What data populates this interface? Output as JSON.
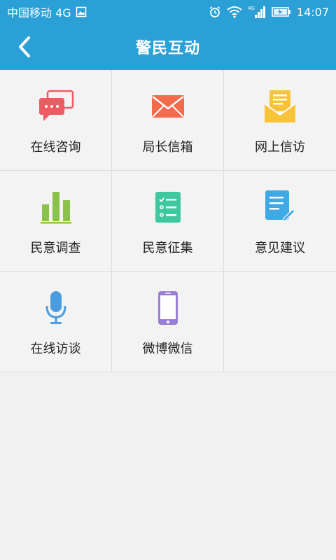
{
  "status_bar": {
    "carrier": "中国移动 4G",
    "network_badge": "4G",
    "time": "14:07",
    "icons": [
      "image-icon",
      "alarm-icon",
      "wifi-icon",
      "signal-icon",
      "battery-icon"
    ]
  },
  "nav": {
    "title": "警民互动",
    "back_icon": "chevron-left-icon"
  },
  "colors": {
    "primary": "#2aa0d6",
    "chat": "#f05a63",
    "mail": "#f26b4d",
    "letter": "#f7c33b",
    "survey": "#8bc34a",
    "collect": "#3fc7a0",
    "suggest": "#3fa9e5",
    "mic": "#4a9de0",
    "phone": "#9b7fd6"
  },
  "grid": {
    "items": [
      {
        "label": "在线咨询",
        "icon": "chat-bubbles-icon"
      },
      {
        "label": "局长信箱",
        "icon": "envelope-icon"
      },
      {
        "label": "网上信访",
        "icon": "letter-icon"
      },
      {
        "label": "民意调查",
        "icon": "bar-chart-icon"
      },
      {
        "label": "民意征集",
        "icon": "checklist-icon"
      },
      {
        "label": "意见建议",
        "icon": "note-pencil-icon"
      },
      {
        "label": "在线访谈",
        "icon": "microphone-icon"
      },
      {
        "label": "微博微信",
        "icon": "smartphone-icon"
      }
    ]
  }
}
